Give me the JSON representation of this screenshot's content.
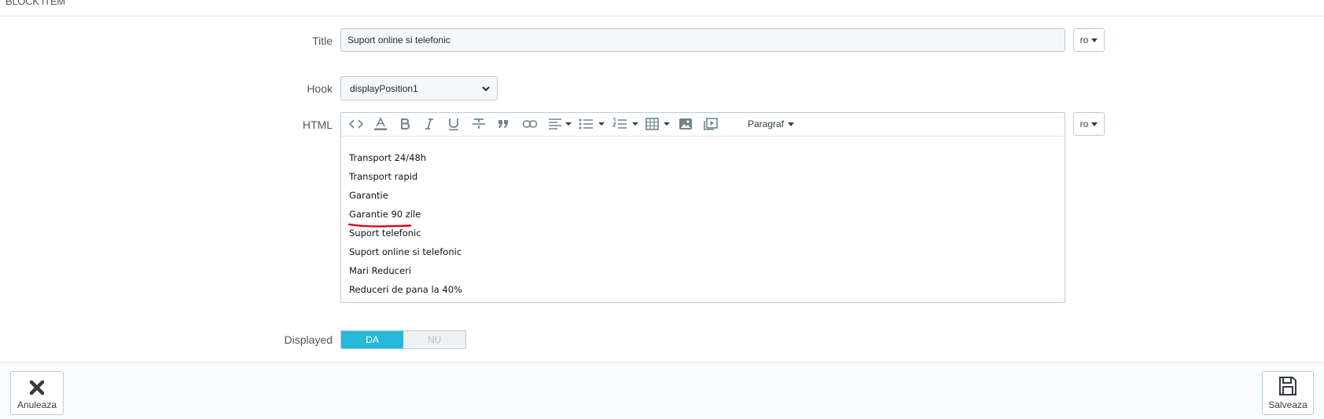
{
  "panel": {
    "heading": "BLOCK ITEM"
  },
  "form": {
    "title_label": "Title",
    "title_value": "Suport online si telefonic",
    "title_lang": "ro",
    "hook_label": "Hook",
    "hook_value": "displayPosition1",
    "html_label": "HTML",
    "html_lang": "ro",
    "displayed_label": "Displayed",
    "displayed_on": "DA",
    "displayed_off": "NU",
    "displayed_value": "DA"
  },
  "editor": {
    "toolbar": [
      "code-view-icon",
      "font-color-icon",
      "bold-icon",
      "italic-icon",
      "underline-icon",
      "strikethrough-icon",
      "blockquote-icon",
      "link-icon",
      "align-icon",
      "bullet-list-icon",
      "numbered-list-icon",
      "table-icon",
      "image-icon",
      "video-icon"
    ],
    "format_label": "Paragraf",
    "lines": [
      "Transport 24/48h",
      "Transport rapid",
      "Garantie",
      "Garantie 90 zile",
      "Suport telefonic",
      "Suport online si telefonic",
      "Mari Reduceri",
      "Reduceri de pana la 40%"
    ]
  },
  "footer": {
    "cancel_label": "Anuleaza",
    "save_label": "Salveaza"
  },
  "colors": {
    "accent": "#25b9d7",
    "annotation": "#e0001b",
    "border": "#bbcdd2"
  }
}
